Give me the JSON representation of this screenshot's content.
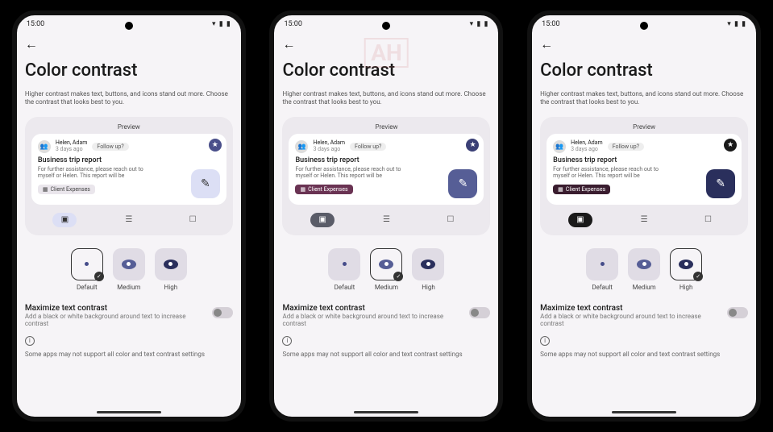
{
  "statusbar": {
    "time": "15:00",
    "icons": "▾ ▮ ▮"
  },
  "back_icon": "←",
  "title": "Color contrast",
  "description": "Higher contrast makes text, buttons, and icons stand out more. Choose the contrast that looks best to you.",
  "preview": {
    "label": "Preview",
    "header": {
      "names": "Helen, Adam",
      "time": "3 days ago",
      "chip": "Follow up?"
    },
    "star": "★",
    "body_title": "Business trip report",
    "body_text": "For further assistance, please reach out to myself or Helen. This report will be",
    "tag": "Client Expenses",
    "tag_icon": "▦",
    "fab": "✎",
    "tabs": {
      "t1": "▣",
      "t2": "☰",
      "t3": "☐"
    }
  },
  "options": {
    "default": "Default",
    "medium": "Medium",
    "high": "High",
    "check": "✓"
  },
  "maximize": {
    "title": "Maximize text contrast",
    "desc": "Add a black or white background around text to increase contrast"
  },
  "info_icon": "i",
  "footnote": "Some apps may not support all color and text contrast settings",
  "watermark": "AH",
  "phones": [
    {
      "selected": "default"
    },
    {
      "selected": "medium"
    },
    {
      "selected": "high"
    }
  ]
}
